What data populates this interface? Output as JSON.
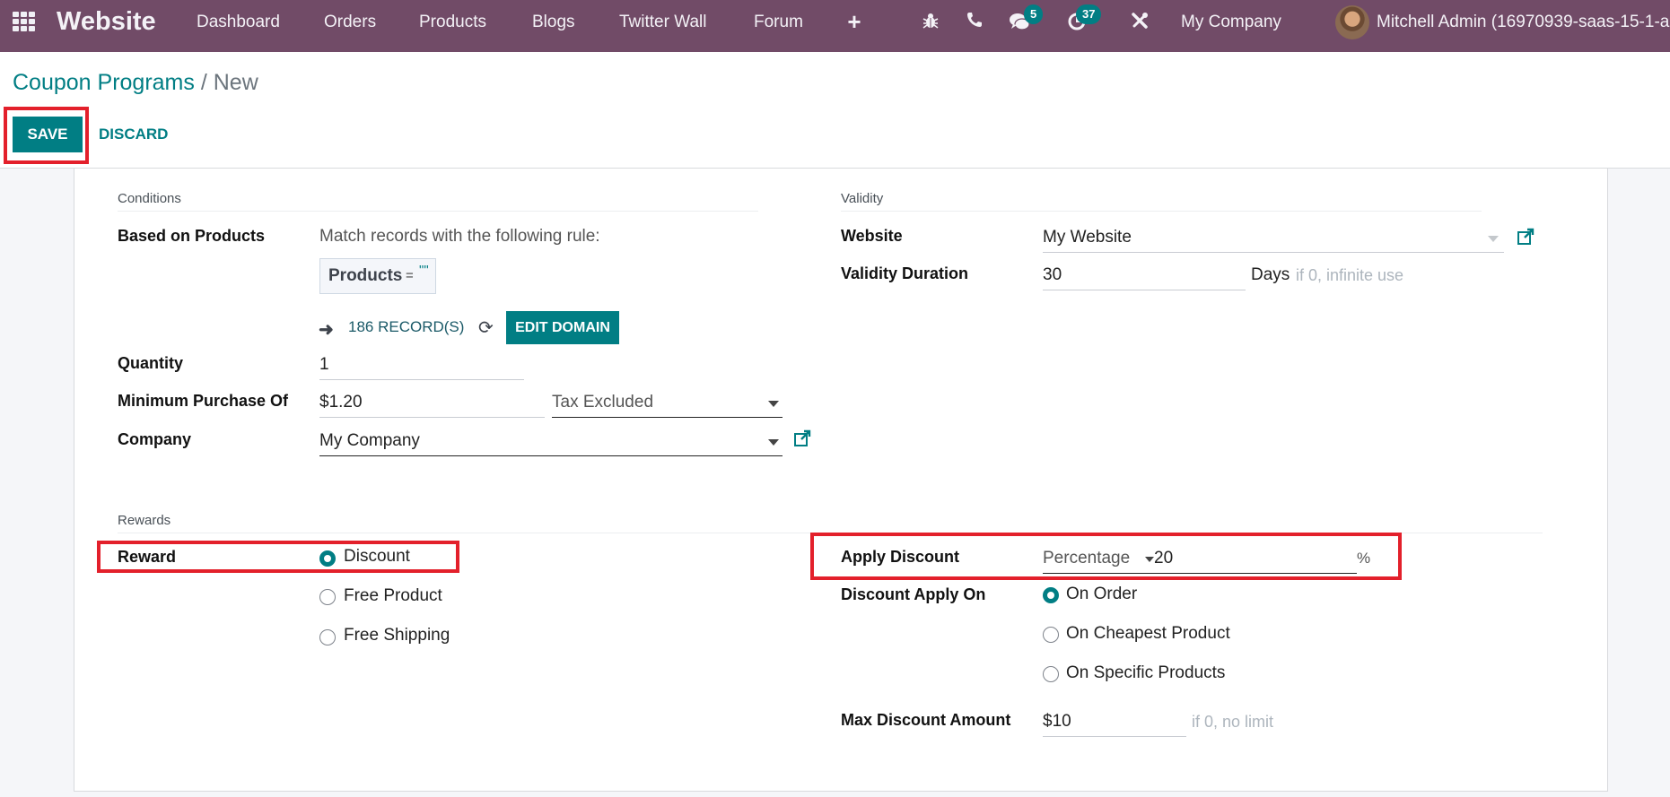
{
  "navbar": {
    "app_name": "Website",
    "menu": [
      "Dashboard",
      "Orders",
      "Products",
      "Blogs",
      "Twitter Wall",
      "Forum"
    ],
    "icons": [
      "apps-grid-icon",
      "plus-icon",
      "bug-icon",
      "phone-icon",
      "chat-icon",
      "activity-clock-icon",
      "tools-icon"
    ],
    "messages_badge": "5",
    "activities_badge": "37",
    "company": "My Company",
    "user": "Mitchell Admin (16970939-saas-15-1-a"
  },
  "breadcrumb": {
    "parent": "Coupon Programs",
    "separator": "/",
    "current": "New"
  },
  "actions": {
    "save_label": "SAVE",
    "discard_label": "DISCARD"
  },
  "conditions": {
    "title": "Conditions",
    "based_on_products_label": "Based on Products",
    "rule_text": "Match records with the following rule:",
    "domain_field": "Products",
    "domain_operator": "=",
    "domain_value": "\"\"",
    "records_label": "186 RECORD(S)",
    "edit_domain_label": "EDIT DOMAIN",
    "quantity_label": "Quantity",
    "quantity_value": "1",
    "min_purchase_label": "Minimum Purchase Of",
    "min_purchase_value": "$1.20",
    "tax_mode_value": "Tax Excluded",
    "company_label": "Company",
    "company_value": "My Company"
  },
  "validity": {
    "title": "Validity",
    "website_label": "Website",
    "website_value": "My Website",
    "duration_label": "Validity Duration",
    "duration_value": "30",
    "duration_unit": "Days",
    "duration_hint": "if 0, infinite use"
  },
  "rewards": {
    "title": "Rewards",
    "reward_label": "Reward",
    "reward_options": [
      {
        "label": "Discount",
        "checked": true
      },
      {
        "label": "Free Product",
        "checked": false
      },
      {
        "label": "Free Shipping",
        "checked": false
      }
    ],
    "apply_discount_label": "Apply Discount",
    "discount_type_value": "Percentage",
    "discount_value": "20",
    "discount_unit": "%",
    "apply_on_label": "Discount Apply On",
    "apply_on_options": [
      {
        "label": "On Order",
        "checked": true
      },
      {
        "label": "On Cheapest Product",
        "checked": false
      },
      {
        "label": "On Specific Products",
        "checked": false
      }
    ],
    "max_discount_label": "Max Discount Amount",
    "max_discount_value": "$10",
    "max_discount_hint": "if 0, no limit"
  },
  "colors": {
    "navbar": "#714b67",
    "primary": "#017e84",
    "highlight": "#e3202b"
  }
}
